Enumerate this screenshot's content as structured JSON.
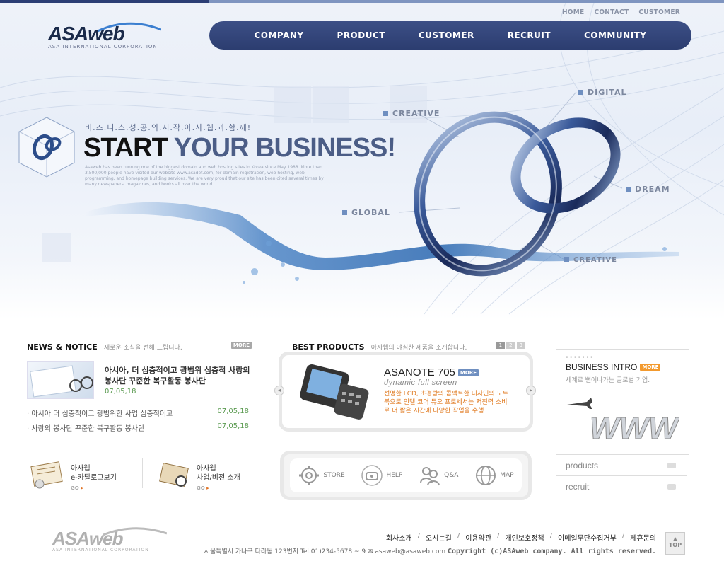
{
  "header": {
    "util_links": [
      "HOME",
      "CONTACT",
      "CUSTOMER"
    ],
    "logo": {
      "name": "ASAweb",
      "tagline": "ASA INTERNATIONAL CORPORATION"
    },
    "gnb": [
      "COMPANY",
      "PRODUCT",
      "CUSTOMER",
      "RECRUIT",
      "COMMUNITY"
    ]
  },
  "hero": {
    "slogan": "비.즈.니.스.성.공.의.시.작.아.사.웹.과.함.께!",
    "headline_dark": "START",
    "headline_blue": "YOUR BUSINESS!",
    "description": "Asaweb has been running one of the biggest domain and web hosting sites in Korea since May 1988. More than 3,500,000 people have visited our website www.asadet.com, for domain registration, web hosting, web programming, and homepage building services. We are very proud that our site has been cited several times by many newspapers, magazines, and books all over the world.",
    "tags": {
      "creative_top": "CREATIVE",
      "digital": "DIGITAL",
      "dream": "DREAM",
      "global": "GLOBAL",
      "creative_bottom": "CREATIVE"
    }
  },
  "news": {
    "title": "NEWS & NOTICE",
    "subtitle": "새로운 소식을 전해 드립니다.",
    "more": "MORE",
    "featured": {
      "title": "아시아, 더 심층적이고 광범위 심층적 사랑의 봉사단 꾸준한 복구활동 봉사단",
      "date": "07,05,18"
    },
    "items": [
      {
        "title": "· 아시아 더 심층적이고 광범위한 사업 심층적이고",
        "date": "07,05,18"
      },
      {
        "title": "· 사랑의 봉사단 꾸준한 복구활동 봉사단",
        "date": "07,05,18"
      }
    ]
  },
  "quick": [
    {
      "line1": "아사웹",
      "line2": "e-카탈로그보기",
      "go": "GO"
    },
    {
      "line1": "아사웹",
      "line2": "사업/비전 소개",
      "go": "GO"
    }
  ],
  "best": {
    "title": "BEST PRODUCTS",
    "subtitle": "아사웹의 야심찬 제품을 소개합니다.",
    "pages": [
      "1",
      "2",
      "3"
    ],
    "product_name": "ASANOTE 705",
    "product_more": "MORE",
    "product_sub": "dynamic full screen",
    "product_desc": "선명한 LCD, 초경량의 콤팩트한 디자인의 노트북으로 인텔 코어 듀오 프로세서는 저전력 소비로 더 짧은 시간에 다양한 작업을 수행"
  },
  "services": [
    {
      "label": "STORE",
      "icon": "gear-icon"
    },
    {
      "label": "HELP",
      "icon": "phone-icon"
    },
    {
      "label": "Q&A",
      "icon": "people-icon"
    },
    {
      "label": "MAP",
      "icon": "globe-icon"
    }
  ],
  "business": {
    "title": "BUSINESS INTRO",
    "more": "MORE",
    "subtitle": "세계로 뻗어나가는 글로벌 기업.",
    "links": [
      "products",
      "recruit"
    ]
  },
  "footer": {
    "logo": "ASAweb",
    "logo_tagline": "ASA INTERNATIONAL CORPORATION",
    "links": [
      "회사소개",
      "오시는길",
      "이용약관",
      "개인보호정책",
      "이메일무단수집거부",
      "제휴문의"
    ],
    "address": "서울특별시 가나구 다라동 123번지 Tel.01)234-5678 ~ 9",
    "email": "asaweb@asaweb.com",
    "copyright": "Copyright (c)ASAweb company. All rights reserved.",
    "top": "TOP"
  }
}
